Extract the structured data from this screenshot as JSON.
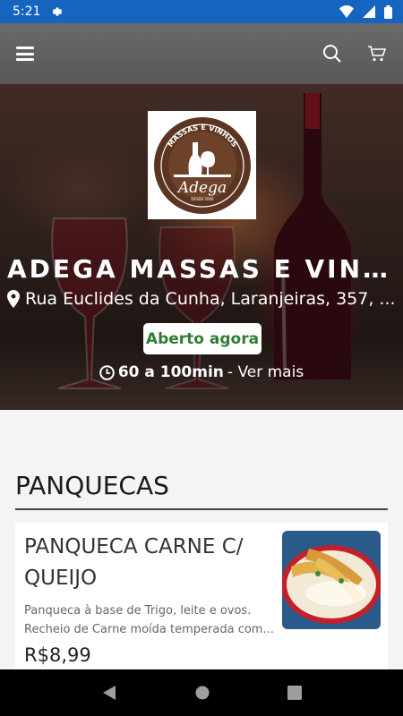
{
  "status_bar": {
    "time": "5:21",
    "background": "#1565c0"
  },
  "app_bar": {
    "icons": [
      "menu-icon",
      "search-icon",
      "cart-icon"
    ],
    "background": "#636363"
  },
  "store": {
    "name": "ADEGA MASSAS E VINHOS",
    "address": "Rua Euclides da Cunha, Laranjeiras, 357, ...",
    "open_label": "Aberto agora",
    "delivery_time": "60 a 100min",
    "delivery_more": " - Ver mais",
    "logo": {
      "arc_text": "MASSAS E VINHOS",
      "script_text": "Adega",
      "small_text": "DESDE 2000"
    }
  },
  "menu": {
    "sections": [
      {
        "title": "PANQUECAS",
        "items": [
          {
            "name": "PANQUECA CARNE C/ QUEIJO",
            "description_line1": "Panqueca à base de Trigo, leite e ovos.",
            "description_line2": "Recheio de Carne moída temperada com...",
            "price": "R$8,99"
          }
        ]
      }
    ]
  },
  "colors": {
    "open_green": "#2e7d32",
    "logo_brown": "#5b3521"
  }
}
